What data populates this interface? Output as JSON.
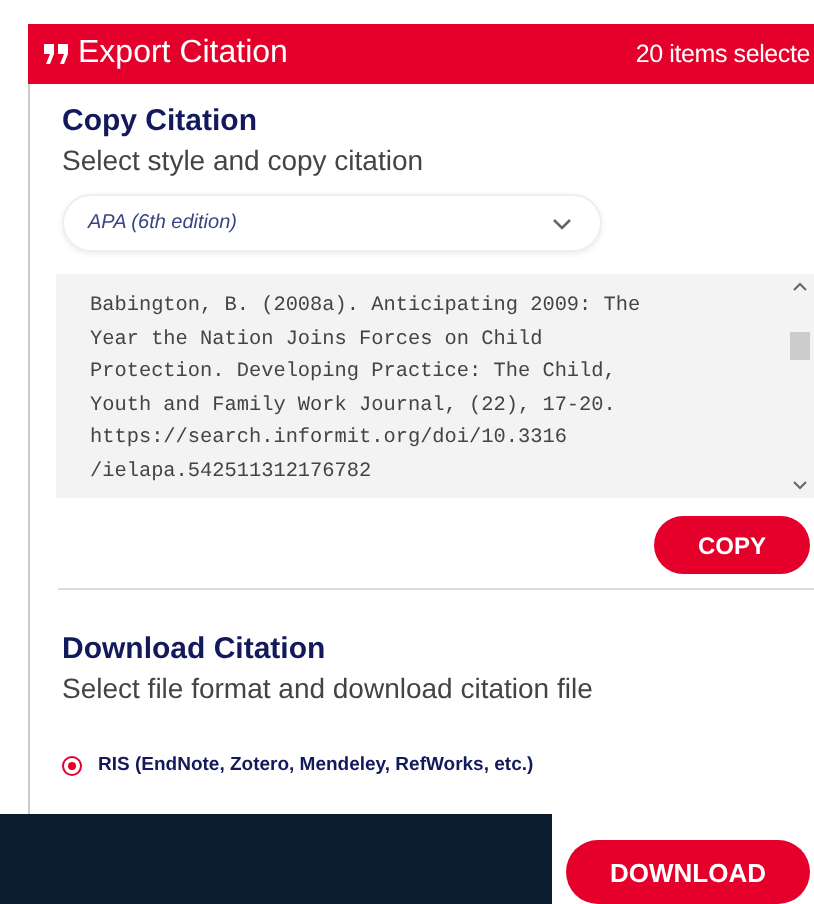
{
  "header": {
    "title": "Export Citation",
    "count": "20 items selecte"
  },
  "copy": {
    "title": "Copy Citation",
    "subtitle": "Select style and copy citation",
    "style_select": {
      "value": "APA (6th edition)"
    },
    "citation_lines": [
      "Babington, B. (2008a). Anticipating 2009: The",
      "Year the Nation Joins Forces on Child",
      "Protection. Developing Practice: The Child,",
      "Youth and Family Work Journal, (22), 17-20.",
      "https://search.informit.org/doi/10.3316",
      "/ielapa.542511312176782"
    ],
    "button": "COPY"
  },
  "download": {
    "title": "Download Citation",
    "subtitle": "Select file format and download citation file",
    "formats": [
      {
        "label": "RIS (EndNote, Zotero, Mendeley, RefWorks, etc.)",
        "selected": true
      }
    ],
    "button": "DOWNLOAD"
  }
}
